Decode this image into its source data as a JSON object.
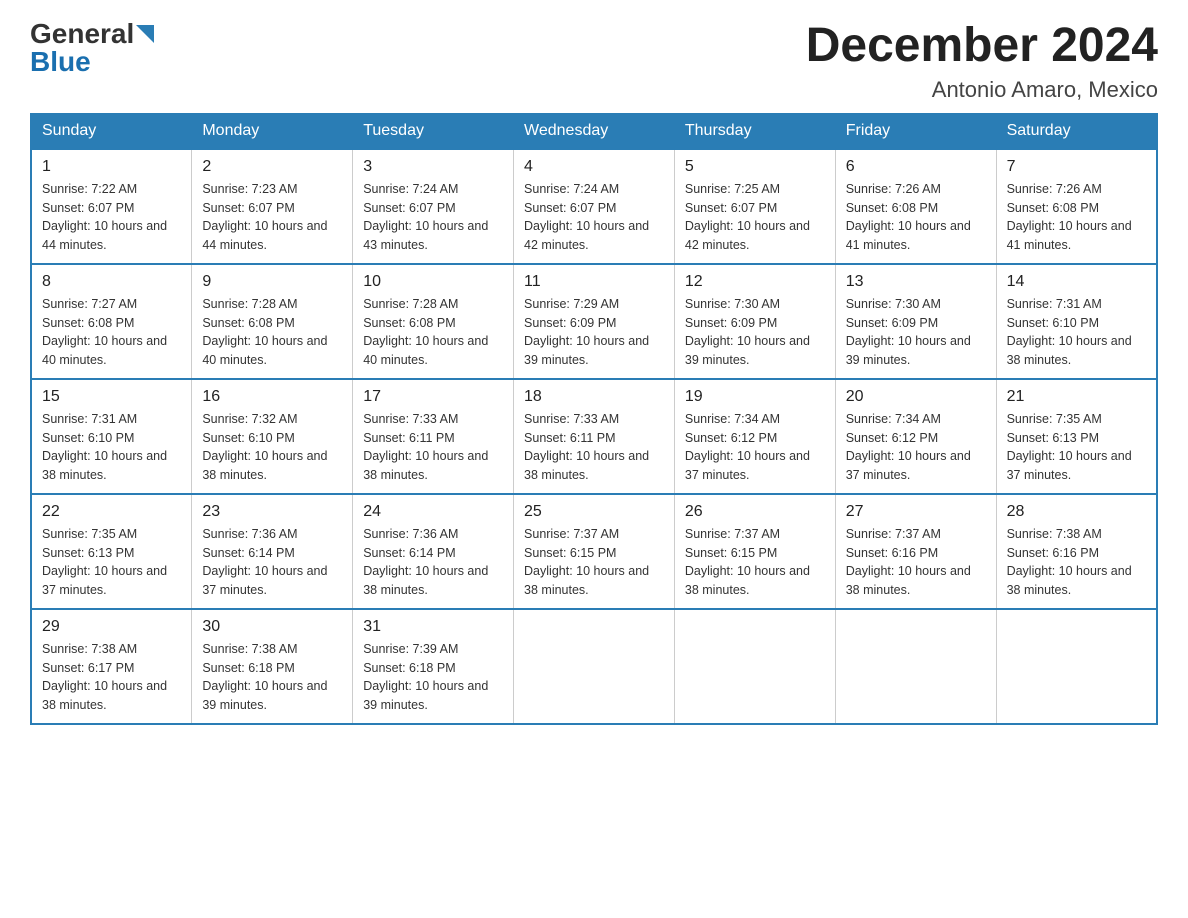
{
  "logo": {
    "general": "General",
    "blue": "Blue"
  },
  "title": {
    "month_year": "December 2024",
    "location": "Antonio Amaro, Mexico"
  },
  "days_of_week": [
    "Sunday",
    "Monday",
    "Tuesday",
    "Wednesday",
    "Thursday",
    "Friday",
    "Saturday"
  ],
  "weeks": [
    [
      {
        "day": "1",
        "sunrise": "7:22 AM",
        "sunset": "6:07 PM",
        "daylight": "10 hours and 44 minutes."
      },
      {
        "day": "2",
        "sunrise": "7:23 AM",
        "sunset": "6:07 PM",
        "daylight": "10 hours and 44 minutes."
      },
      {
        "day": "3",
        "sunrise": "7:24 AM",
        "sunset": "6:07 PM",
        "daylight": "10 hours and 43 minutes."
      },
      {
        "day": "4",
        "sunrise": "7:24 AM",
        "sunset": "6:07 PM",
        "daylight": "10 hours and 42 minutes."
      },
      {
        "day": "5",
        "sunrise": "7:25 AM",
        "sunset": "6:07 PM",
        "daylight": "10 hours and 42 minutes."
      },
      {
        "day": "6",
        "sunrise": "7:26 AM",
        "sunset": "6:08 PM",
        "daylight": "10 hours and 41 minutes."
      },
      {
        "day": "7",
        "sunrise": "7:26 AM",
        "sunset": "6:08 PM",
        "daylight": "10 hours and 41 minutes."
      }
    ],
    [
      {
        "day": "8",
        "sunrise": "7:27 AM",
        "sunset": "6:08 PM",
        "daylight": "10 hours and 40 minutes."
      },
      {
        "day": "9",
        "sunrise": "7:28 AM",
        "sunset": "6:08 PM",
        "daylight": "10 hours and 40 minutes."
      },
      {
        "day": "10",
        "sunrise": "7:28 AM",
        "sunset": "6:08 PM",
        "daylight": "10 hours and 40 minutes."
      },
      {
        "day": "11",
        "sunrise": "7:29 AM",
        "sunset": "6:09 PM",
        "daylight": "10 hours and 39 minutes."
      },
      {
        "day": "12",
        "sunrise": "7:30 AM",
        "sunset": "6:09 PM",
        "daylight": "10 hours and 39 minutes."
      },
      {
        "day": "13",
        "sunrise": "7:30 AM",
        "sunset": "6:09 PM",
        "daylight": "10 hours and 39 minutes."
      },
      {
        "day": "14",
        "sunrise": "7:31 AM",
        "sunset": "6:10 PM",
        "daylight": "10 hours and 38 minutes."
      }
    ],
    [
      {
        "day": "15",
        "sunrise": "7:31 AM",
        "sunset": "6:10 PM",
        "daylight": "10 hours and 38 minutes."
      },
      {
        "day": "16",
        "sunrise": "7:32 AM",
        "sunset": "6:10 PM",
        "daylight": "10 hours and 38 minutes."
      },
      {
        "day": "17",
        "sunrise": "7:33 AM",
        "sunset": "6:11 PM",
        "daylight": "10 hours and 38 minutes."
      },
      {
        "day": "18",
        "sunrise": "7:33 AM",
        "sunset": "6:11 PM",
        "daylight": "10 hours and 38 minutes."
      },
      {
        "day": "19",
        "sunrise": "7:34 AM",
        "sunset": "6:12 PM",
        "daylight": "10 hours and 37 minutes."
      },
      {
        "day": "20",
        "sunrise": "7:34 AM",
        "sunset": "6:12 PM",
        "daylight": "10 hours and 37 minutes."
      },
      {
        "day": "21",
        "sunrise": "7:35 AM",
        "sunset": "6:13 PM",
        "daylight": "10 hours and 37 minutes."
      }
    ],
    [
      {
        "day": "22",
        "sunrise": "7:35 AM",
        "sunset": "6:13 PM",
        "daylight": "10 hours and 37 minutes."
      },
      {
        "day": "23",
        "sunrise": "7:36 AM",
        "sunset": "6:14 PM",
        "daylight": "10 hours and 37 minutes."
      },
      {
        "day": "24",
        "sunrise": "7:36 AM",
        "sunset": "6:14 PM",
        "daylight": "10 hours and 38 minutes."
      },
      {
        "day": "25",
        "sunrise": "7:37 AM",
        "sunset": "6:15 PM",
        "daylight": "10 hours and 38 minutes."
      },
      {
        "day": "26",
        "sunrise": "7:37 AM",
        "sunset": "6:15 PM",
        "daylight": "10 hours and 38 minutes."
      },
      {
        "day": "27",
        "sunrise": "7:37 AM",
        "sunset": "6:16 PM",
        "daylight": "10 hours and 38 minutes."
      },
      {
        "day": "28",
        "sunrise": "7:38 AM",
        "sunset": "6:16 PM",
        "daylight": "10 hours and 38 minutes."
      }
    ],
    [
      {
        "day": "29",
        "sunrise": "7:38 AM",
        "sunset": "6:17 PM",
        "daylight": "10 hours and 38 minutes."
      },
      {
        "day": "30",
        "sunrise": "7:38 AM",
        "sunset": "6:18 PM",
        "daylight": "10 hours and 39 minutes."
      },
      {
        "day": "31",
        "sunrise": "7:39 AM",
        "sunset": "6:18 PM",
        "daylight": "10 hours and 39 minutes."
      },
      null,
      null,
      null,
      null
    ]
  ]
}
